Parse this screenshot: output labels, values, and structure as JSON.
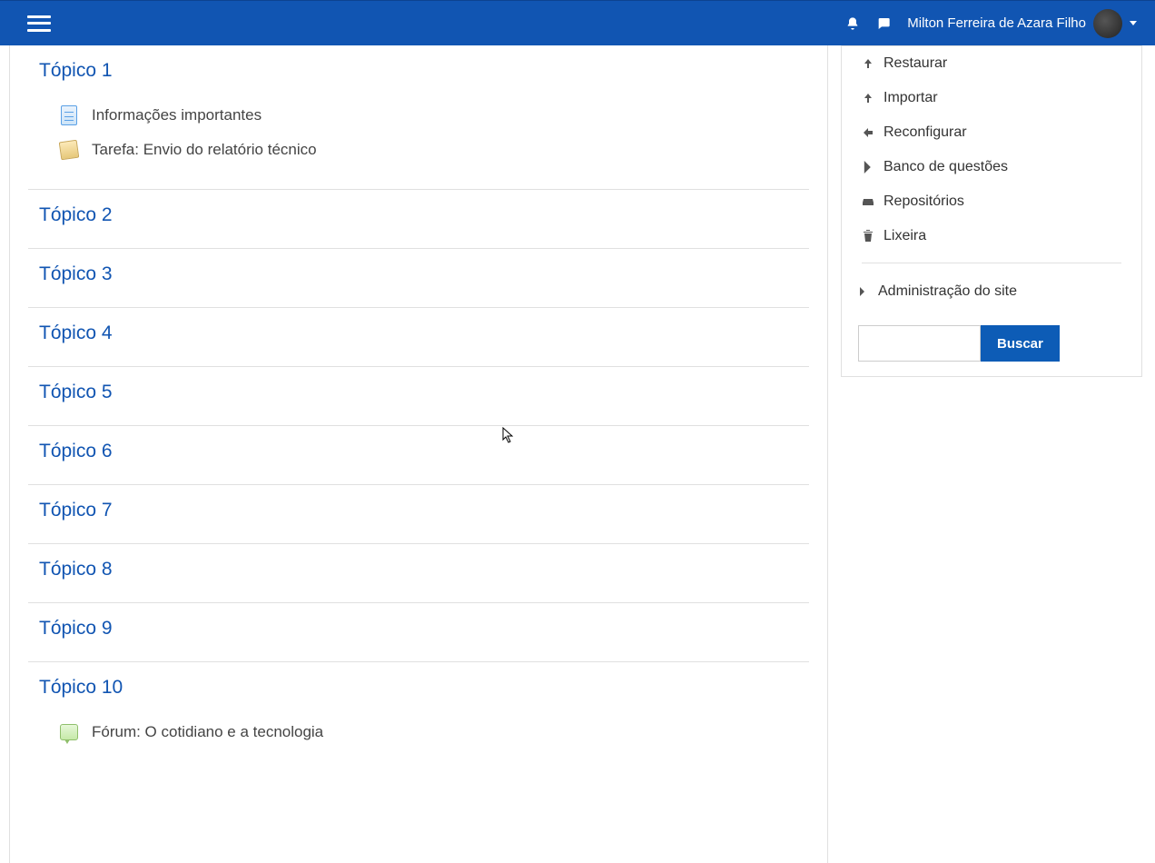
{
  "navbar": {
    "user_name": "Milton Ferreira de Azara Filho"
  },
  "topics": [
    {
      "title": "Tópico 1",
      "activities": [
        {
          "icon": "page",
          "label": "Informações importantes"
        },
        {
          "icon": "assign",
          "label": "Tarefa: Envio do relatório técnico"
        }
      ]
    },
    {
      "title": "Tópico 2",
      "activities": []
    },
    {
      "title": "Tópico 3",
      "activities": []
    },
    {
      "title": "Tópico 4",
      "activities": []
    },
    {
      "title": "Tópico 5",
      "activities": []
    },
    {
      "title": "Tópico 6",
      "activities": []
    },
    {
      "title": "Tópico 7",
      "activities": []
    },
    {
      "title": "Tópico 8",
      "activities": []
    },
    {
      "title": "Tópico 9",
      "activities": []
    },
    {
      "title": "Tópico 10",
      "activities": [
        {
          "icon": "forum",
          "label": "Fórum: O cotidiano e a tecnologia"
        }
      ]
    }
  ],
  "admin": {
    "items": [
      {
        "icon": "up",
        "label": "Restaurar"
      },
      {
        "icon": "up",
        "label": "Importar"
      },
      {
        "icon": "back",
        "label": "Reconfigurar"
      },
      {
        "icon": "chev",
        "label": "Banco de questões"
      },
      {
        "icon": "drive",
        "label": "Repositórios"
      },
      {
        "icon": "trash",
        "label": "Lixeira"
      }
    ],
    "root": "Administração do site",
    "search_button": "Buscar"
  }
}
